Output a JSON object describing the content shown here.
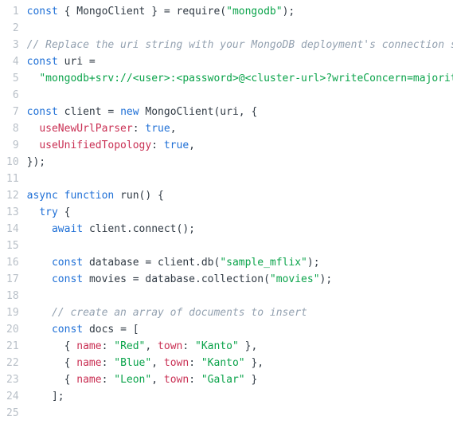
{
  "colors": {
    "keyword": "#1e6fd6",
    "string": "#0aa34a",
    "property": "#c92f53",
    "comment": "#93a1b0",
    "gutter": "#b9c0c8",
    "text": "#303a44",
    "background": "#ffffff"
  },
  "line_numbers": [
    "1",
    "2",
    "3",
    "4",
    "5",
    "6",
    "7",
    "8",
    "9",
    "10",
    "11",
    "12",
    "13",
    "14",
    "15",
    "16",
    "17",
    "18",
    "19",
    "20",
    "21",
    "22",
    "23",
    "24",
    "25"
  ],
  "code_lines": [
    {
      "n": 1,
      "segments": [
        {
          "t": "const ",
          "c": "decl"
        },
        {
          "t": "{ MongoClient } = require(",
          "c": "pun"
        },
        {
          "t": "\"mongodb\"",
          "c": "str"
        },
        {
          "t": ");",
          "c": "pun"
        }
      ]
    },
    {
      "n": 2,
      "segments": []
    },
    {
      "n": 3,
      "segments": [
        {
          "t": "// Replace the uri string with your MongoDB deployment's connection string.",
          "c": "com"
        }
      ]
    },
    {
      "n": 4,
      "segments": [
        {
          "t": "const ",
          "c": "decl"
        },
        {
          "t": "uri =",
          "c": "pun"
        }
      ]
    },
    {
      "n": 5,
      "segments": [
        {
          "t": "  ",
          "c": "pun"
        },
        {
          "t": "\"mongodb+srv://<user>:<password>@<cluster-url>?writeConcern=majority\"",
          "c": "str"
        },
        {
          "t": ";",
          "c": "pun"
        }
      ]
    },
    {
      "n": 6,
      "segments": []
    },
    {
      "n": 7,
      "segments": [
        {
          "t": "const ",
          "c": "decl"
        },
        {
          "t": "client = ",
          "c": "pun"
        },
        {
          "t": "new ",
          "c": "kw"
        },
        {
          "t": "MongoClient(uri, {",
          "c": "pun"
        }
      ]
    },
    {
      "n": 8,
      "segments": [
        {
          "t": "  ",
          "c": "pun"
        },
        {
          "t": "useNewUrlParser",
          "c": "prop"
        },
        {
          "t": ": ",
          "c": "pun"
        },
        {
          "t": "true",
          "c": "bool"
        },
        {
          "t": ",",
          "c": "pun"
        }
      ]
    },
    {
      "n": 9,
      "segments": [
        {
          "t": "  ",
          "c": "pun"
        },
        {
          "t": "useUnifiedTopology",
          "c": "prop"
        },
        {
          "t": ": ",
          "c": "pun"
        },
        {
          "t": "true",
          "c": "bool"
        },
        {
          "t": ",",
          "c": "pun"
        }
      ]
    },
    {
      "n": 10,
      "segments": [
        {
          "t": "});",
          "c": "pun"
        }
      ]
    },
    {
      "n": 11,
      "segments": []
    },
    {
      "n": 12,
      "segments": [
        {
          "t": "async function ",
          "c": "kw"
        },
        {
          "t": "run() {",
          "c": "pun"
        }
      ]
    },
    {
      "n": 13,
      "segments": [
        {
          "t": "  ",
          "c": "pun"
        },
        {
          "t": "try ",
          "c": "kw"
        },
        {
          "t": "{",
          "c": "pun"
        }
      ]
    },
    {
      "n": 14,
      "segments": [
        {
          "t": "    ",
          "c": "pun"
        },
        {
          "t": "await ",
          "c": "kw"
        },
        {
          "t": "client.connect();",
          "c": "pun"
        }
      ]
    },
    {
      "n": 15,
      "segments": []
    },
    {
      "n": 16,
      "segments": [
        {
          "t": "    ",
          "c": "pun"
        },
        {
          "t": "const ",
          "c": "decl"
        },
        {
          "t": "database = client.db(",
          "c": "pun"
        },
        {
          "t": "\"sample_mflix\"",
          "c": "str"
        },
        {
          "t": ");",
          "c": "pun"
        }
      ]
    },
    {
      "n": 17,
      "segments": [
        {
          "t": "    ",
          "c": "pun"
        },
        {
          "t": "const ",
          "c": "decl"
        },
        {
          "t": "movies = database.collection(",
          "c": "pun"
        },
        {
          "t": "\"movies\"",
          "c": "str"
        },
        {
          "t": ");",
          "c": "pun"
        }
      ]
    },
    {
      "n": 18,
      "segments": []
    },
    {
      "n": 19,
      "segments": [
        {
          "t": "    ",
          "c": "pun"
        },
        {
          "t": "// create an array of documents to insert",
          "c": "com"
        }
      ]
    },
    {
      "n": 20,
      "segments": [
        {
          "t": "    ",
          "c": "pun"
        },
        {
          "t": "const ",
          "c": "decl"
        },
        {
          "t": "docs = [",
          "c": "pun"
        }
      ]
    },
    {
      "n": 21,
      "segments": [
        {
          "t": "      { ",
          "c": "pun"
        },
        {
          "t": "name",
          "c": "prop"
        },
        {
          "t": ": ",
          "c": "pun"
        },
        {
          "t": "\"Red\"",
          "c": "str"
        },
        {
          "t": ", ",
          "c": "pun"
        },
        {
          "t": "town",
          "c": "prop"
        },
        {
          "t": ": ",
          "c": "pun"
        },
        {
          "t": "\"Kanto\"",
          "c": "str"
        },
        {
          "t": " },",
          "c": "pun"
        }
      ]
    },
    {
      "n": 22,
      "segments": [
        {
          "t": "      { ",
          "c": "pun"
        },
        {
          "t": "name",
          "c": "prop"
        },
        {
          "t": ": ",
          "c": "pun"
        },
        {
          "t": "\"Blue\"",
          "c": "str"
        },
        {
          "t": ", ",
          "c": "pun"
        },
        {
          "t": "town",
          "c": "prop"
        },
        {
          "t": ": ",
          "c": "pun"
        },
        {
          "t": "\"Kanto\"",
          "c": "str"
        },
        {
          "t": " },",
          "c": "pun"
        }
      ]
    },
    {
      "n": 23,
      "segments": [
        {
          "t": "      { ",
          "c": "pun"
        },
        {
          "t": "name",
          "c": "prop"
        },
        {
          "t": ": ",
          "c": "pun"
        },
        {
          "t": "\"Leon\"",
          "c": "str"
        },
        {
          "t": ", ",
          "c": "pun"
        },
        {
          "t": "town",
          "c": "prop"
        },
        {
          "t": ": ",
          "c": "pun"
        },
        {
          "t": "\"Galar\"",
          "c": "str"
        },
        {
          "t": " }",
          "c": "pun"
        }
      ]
    },
    {
      "n": 24,
      "segments": [
        {
          "t": "    ];",
          "c": "pun"
        }
      ]
    },
    {
      "n": 25,
      "segments": []
    }
  ]
}
